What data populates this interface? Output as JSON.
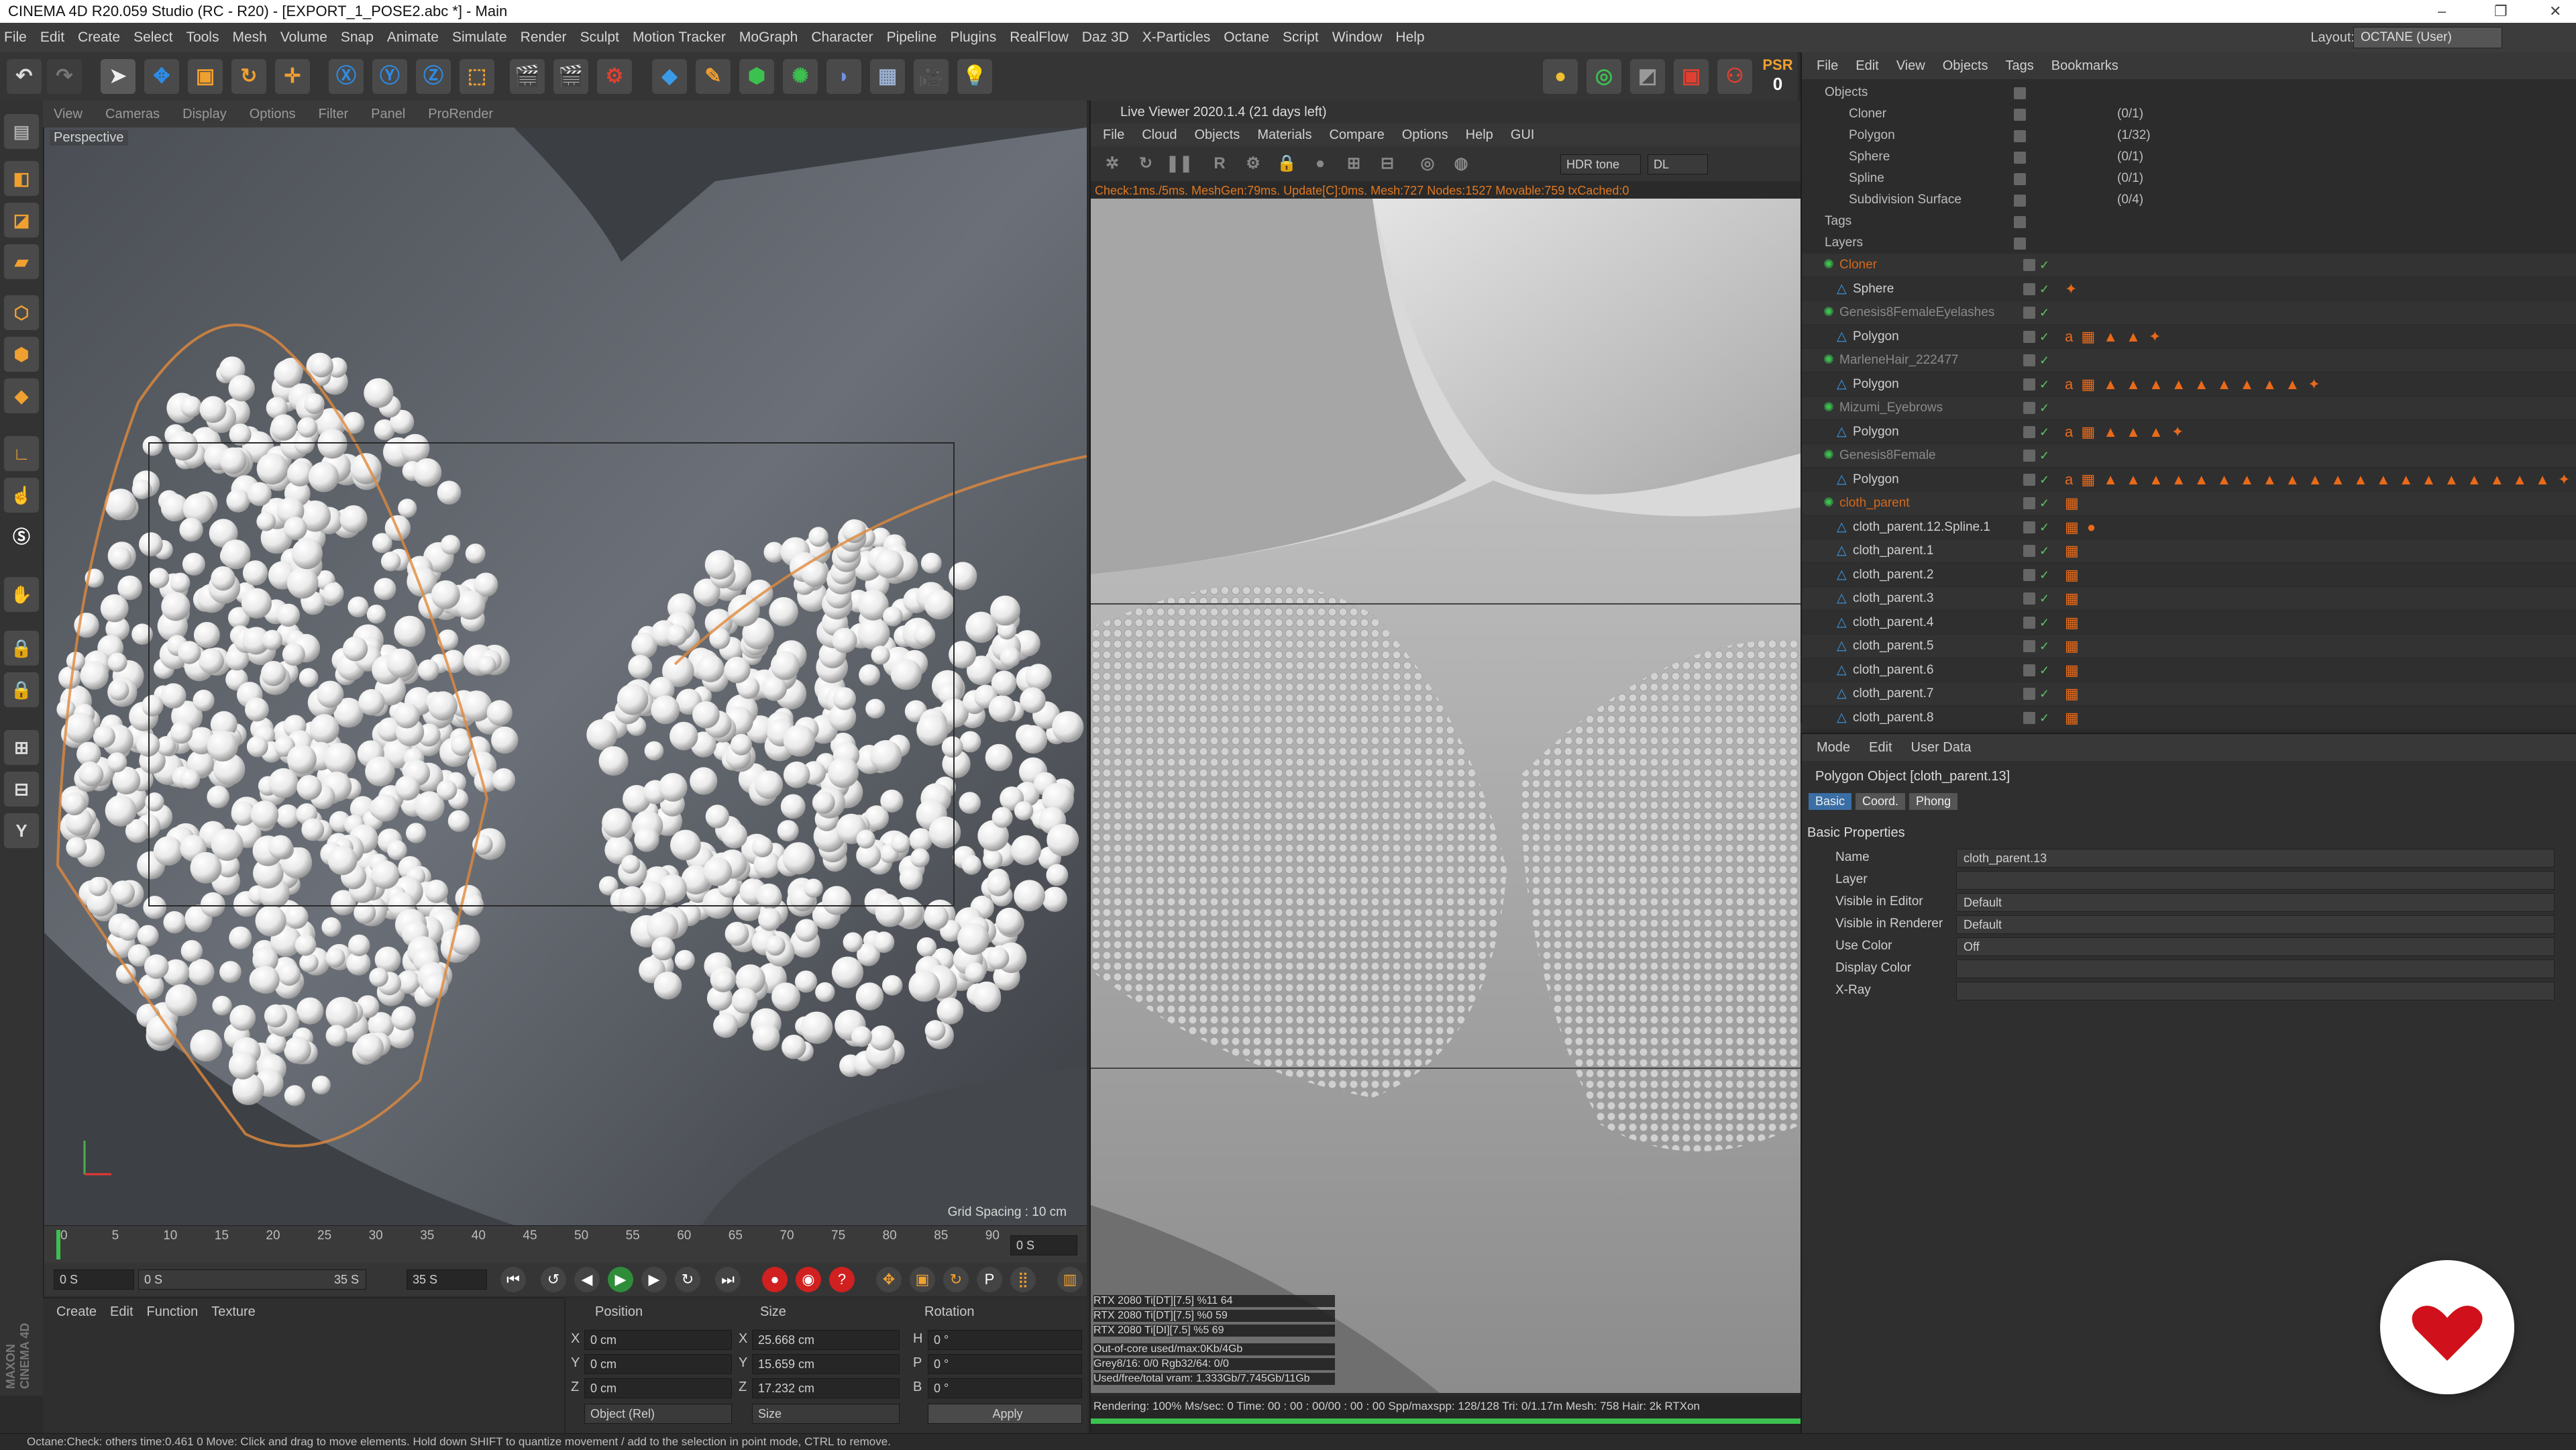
{
  "window": {
    "title": "CINEMA 4D R20.059 Studio (RC - R20) - [EXPORT_1_POSE2.abc *] - Main",
    "controls": [
      "–",
      "❐",
      "✕"
    ]
  },
  "menubar": {
    "items": [
      "File",
      "Edit",
      "Create",
      "Select",
      "Tools",
      "Mesh",
      "Volume",
      "Snap",
      "Animate",
      "Simulate",
      "Render",
      "Sculpt",
      "Motion Tracker",
      "MoGraph",
      "Character",
      "Pipeline",
      "Plugins",
      "RealFlow",
      "Daz 3D",
      "X-Particles",
      "Octane",
      "Script",
      "Window",
      "Help"
    ],
    "layout_label": "Layout:",
    "layout_value": "OCTANE (User)"
  },
  "toolbar": {
    "psr_label": "PSR",
    "psr_value": "0"
  },
  "viewport": {
    "menu": [
      "View",
      "Cameras",
      "Display",
      "Options",
      "Filter",
      "Panel",
      "ProRender"
    ],
    "camera_label": "Perspective",
    "grid_spacing": "Grid Spacing : 10 cm"
  },
  "timeline": {
    "ticks": [
      "0",
      "5",
      "10",
      "15",
      "20",
      "25",
      "30",
      "35",
      "40",
      "45",
      "50",
      "55",
      "60",
      "65",
      "70",
      "75",
      "80",
      "85",
      "90"
    ],
    "current_frame": "0 S"
  },
  "playback": {
    "start": "0 S",
    "range_start": "0 S",
    "range_end": "35 S",
    "end": "35 S"
  },
  "material_manager": {
    "menu": [
      "Create",
      "Edit",
      "Function",
      "Texture"
    ]
  },
  "coordinates": {
    "headers": [
      "Position",
      "Size",
      "Rotation"
    ],
    "rows": [
      {
        "axis": "X",
        "pos": "0 cm",
        "size_axis": "X",
        "size": "25.668 cm",
        "rot_axis": "H",
        "rot": "0 °"
      },
      {
        "axis": "Y",
        "pos": "0 cm",
        "size_axis": "Y",
        "size": "15.659 cm",
        "rot_axis": "P",
        "rot": "0 °"
      },
      {
        "axis": "Z",
        "pos": "0 cm",
        "size_axis": "Z",
        "size": "17.232 cm",
        "rot_axis": "B",
        "rot": "0 °"
      }
    ],
    "mode": "Object (Rel)",
    "size_mode": "Size",
    "apply": "Apply"
  },
  "live_viewer": {
    "title": "Live Viewer 2020.1.4 (21 days left)",
    "menu": [
      "File",
      "Cloud",
      "Objects",
      "Materials",
      "Compare",
      "Options",
      "Help",
      "GUI"
    ],
    "tonemap": "HDR tone",
    "kernel": "DL",
    "status": "Check:1ms./5ms. MeshGen:79ms. Update[C]:0ms. Mesh:727 Nodes:1527 Movable:759 txCached:0",
    "gpus": [
      "RTX 2080 Ti[DT][7.5]   %11   64",
      "RTX 2080 Ti[DT][7.5]   %0    59",
      "RTX 2080 Ti[DI][7.5]   %5    69"
    ],
    "mem": [
      "Out-of-core used/max:0Kb/4Gb",
      "Grey8/16: 0/0          Rgb32/64: 0/0",
      "Used/free/total vram: 1.333Gb/7.745Gb/11Gb"
    ],
    "render_line": "Rendering: 100%  Ms/sec: 0   Time: 00 : 00 : 00/00 : 00 : 00  Spp/maxspp: 128/128   Tri: 0/1.17m   Mesh: 758   Hair: 2k   RTXon"
  },
  "object_manager": {
    "menu": [
      "File",
      "Edit",
      "View",
      "Objects",
      "Tags",
      "Bookmarks"
    ],
    "top_rows": [
      {
        "name": "Objects",
        "count": ""
      },
      {
        "name": "Cloner",
        "count": "(0/1)"
      },
      {
        "name": "Polygon",
        "count": "(1/32)"
      },
      {
        "name": "Sphere",
        "count": "(0/1)"
      },
      {
        "name": "Spline",
        "count": "(0/1)"
      },
      {
        "name": "Subdivision Surface",
        "count": "(0/4)"
      },
      {
        "name": "Tags",
        "count": ""
      },
      {
        "name": "Layers",
        "count": ""
      }
    ],
    "tree": [
      {
        "name": "Cloner",
        "level": 0,
        "color": "#d2691e",
        "tags": ""
      },
      {
        "name": "Sphere",
        "level": 1,
        "color": "#cfcfcf",
        "tags": "✦"
      },
      {
        "name": "Genesis8FemaleEyelashes",
        "level": 0,
        "color": "#8a8a8a",
        "tags": ""
      },
      {
        "name": "Polygon",
        "level": 1,
        "color": "#cfcfcf",
        "tags": "a ▦ ▲ ▲ ✦"
      },
      {
        "name": "MarleneHair_222477",
        "level": 0,
        "color": "#8a8a8a",
        "tags": ""
      },
      {
        "name": "Polygon",
        "level": 1,
        "color": "#cfcfcf",
        "tags": "a ▦ ▲ ▲ ▲ ▲ ▲ ▲ ▲ ▲ ▲ ✦"
      },
      {
        "name": "Mizumi_Eyebrows",
        "level": 0,
        "color": "#8a8a8a",
        "tags": ""
      },
      {
        "name": "Polygon",
        "level": 1,
        "color": "#cfcfcf",
        "tags": "a ▦ ▲ ▲ ▲ ✦"
      },
      {
        "name": "Genesis8Female",
        "level": 0,
        "color": "#8a8a8a",
        "tags": ""
      },
      {
        "name": "Polygon",
        "level": 1,
        "color": "#cfcfcf",
        "tags": "a ▦ ▲ ▲ ▲ ▲ ▲ ▲ ▲ ▲ ▲ ▲ ▲ ▲ ▲ ▲ ▲ ▲ ▲ ▲ ▲ ▲ ✦"
      },
      {
        "name": "cloth_parent",
        "level": 0,
        "color": "#d2691e",
        "tags": "▦"
      },
      {
        "name": "cloth_parent.12.Spline.1",
        "level": 1,
        "color": "#cfcfcf",
        "tags": "▦ ●"
      },
      {
        "name": "cloth_parent.1",
        "level": 1,
        "color": "#cfcfcf",
        "tags": "▦"
      },
      {
        "name": "cloth_parent.2",
        "level": 1,
        "color": "#cfcfcf",
        "tags": "▦"
      },
      {
        "name": "cloth_parent.3",
        "level": 1,
        "color": "#cfcfcf",
        "tags": "▦"
      },
      {
        "name": "cloth_parent.4",
        "level": 1,
        "color": "#cfcfcf",
        "tags": "▦"
      },
      {
        "name": "cloth_parent.5",
        "level": 1,
        "color": "#cfcfcf",
        "tags": "▦"
      },
      {
        "name": "cloth_parent.6",
        "level": 1,
        "color": "#cfcfcf",
        "tags": "▦"
      },
      {
        "name": "cloth_parent.7",
        "level": 1,
        "color": "#cfcfcf",
        "tags": "▦"
      },
      {
        "name": "cloth_parent.8",
        "level": 1,
        "color": "#cfcfcf",
        "tags": "▦"
      }
    ]
  },
  "attribute_manager": {
    "menu": [
      "Mode",
      "Edit",
      "User Data"
    ],
    "object_title": "Polygon Object [cloth_parent.13]",
    "tabs": [
      "Basic",
      "Coord.",
      "Phong"
    ],
    "section": "Basic Properties",
    "fields": [
      {
        "label": "Name",
        "value": "cloth_parent.13"
      },
      {
        "label": "Layer",
        "value": ""
      },
      {
        "label": "Visible in Editor",
        "value": "Default"
      },
      {
        "label": "Visible in Renderer",
        "value": "Default"
      },
      {
        "label": "Use Color",
        "value": "Off"
      },
      {
        "label": "Display Color",
        "value": ""
      },
      {
        "label": "X-Ray",
        "value": ""
      }
    ]
  },
  "statusbar": {
    "text": "Octane:Check: others time:0.461  0      Move: Click and drag to move elements. Hold down SHIFT to quantize movement / add to the selection in point mode, CTRL to remove."
  },
  "colors": {
    "accent": "#e86a1a",
    "logo_red": "#d0101a",
    "panel": "#2c2c2c"
  }
}
